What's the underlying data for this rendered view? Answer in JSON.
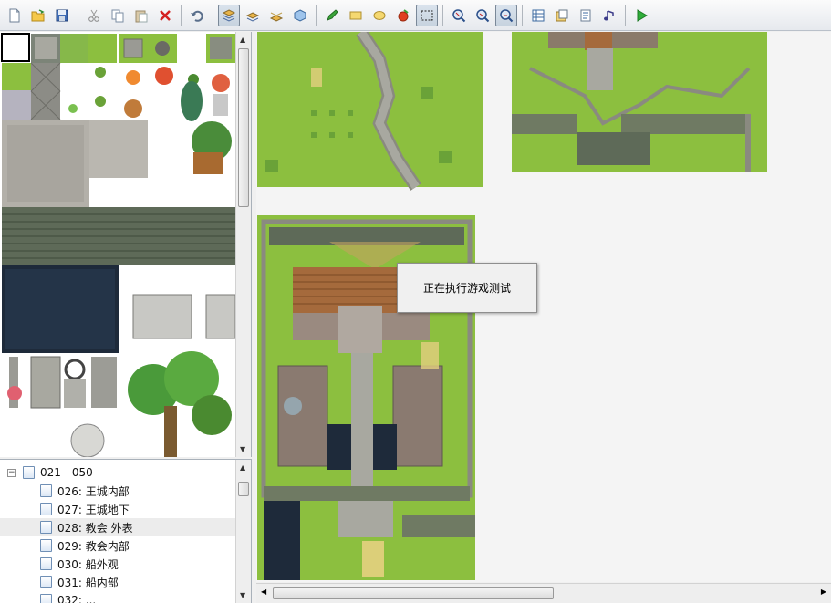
{
  "toolbar": {
    "buttons": [
      "new-icon",
      "open-icon",
      "save-icon",
      "cut-icon",
      "copy-icon",
      "paste-icon",
      "delete-icon",
      "undo-icon",
      "layer1-icon",
      "layer2-icon",
      "layer3-icon",
      "event-layer-icon",
      "pencil-icon",
      "rectangle-icon",
      "ellipse-icon",
      "fill-icon",
      "select-icon",
      "zoom-1-icon",
      "zoom-2-icon",
      "zoom-4-icon",
      "database-icon",
      "materials-icon",
      "script-icon",
      "sound-icon",
      "play-icon"
    ]
  },
  "tree": {
    "group_label": "021 - 050",
    "items": [
      {
        "label": "026: 王城内部"
      },
      {
        "label": "027: 王城地下"
      },
      {
        "label": "028: 教会 外表"
      },
      {
        "label": "029: 教会内部"
      },
      {
        "label": "030: 船外观"
      },
      {
        "label": "031: 船内部"
      },
      {
        "label": "032: ..."
      }
    ]
  },
  "dialog": {
    "message": "正在执行游戏测试"
  },
  "colors": {
    "grass": "#8cbf3f",
    "grass_dark": "#6aa238",
    "stone": "#a8a8a0",
    "path": "#b8b4a8",
    "roof": "#a56a3c",
    "water": "#1e2a3a",
    "wall": "#6f7a63"
  }
}
